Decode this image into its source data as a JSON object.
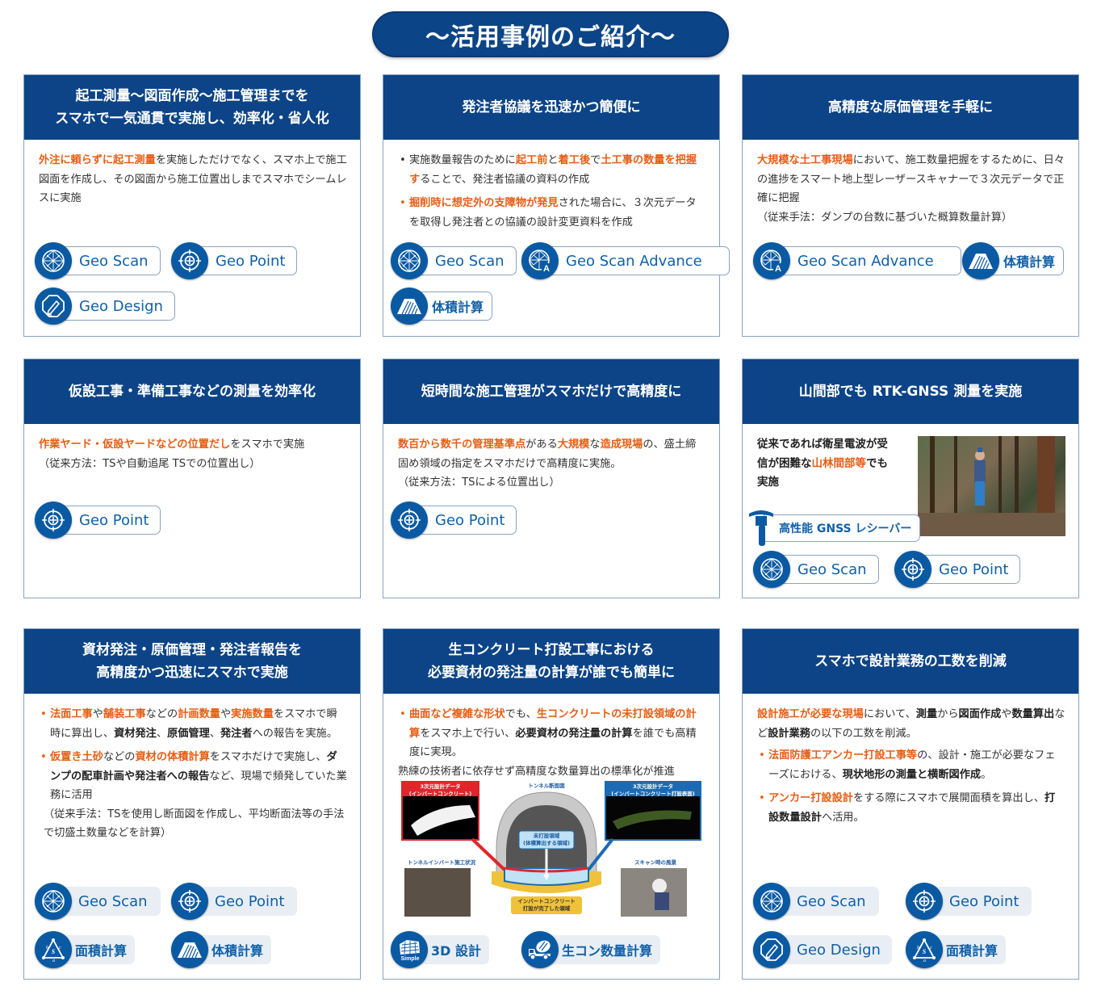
{
  "banner": {
    "title": "〜活用事例のご紹介〜"
  },
  "colors": {
    "navy": "#0c4487",
    "accent_orange": "#e85d13",
    "pill_blue": "#0a5aa3",
    "pill_text": "#1060a8"
  },
  "cards": [
    {
      "title_lines": [
        "起工測量〜図面作成〜施工管理までを",
        "スマホで一気通貫で実施し、効率化・省人化"
      ],
      "body": [
        {
          "t": "外注に頼らずに起工測量",
          "s": "hl"
        },
        {
          "t": "を実施しただけでなく、スマホ上で施工図面を作成し、その図面から施工位置出しまでスマホでシームレスに実施",
          "s": ""
        }
      ],
      "tools": [
        {
          "label": "Geo Scan",
          "icon": "geodesic-sphere-icon"
        },
        {
          "label": "Geo Point",
          "icon": "crosshair-target-icon"
        },
        {
          "label": "Geo Design",
          "icon": "pencil-octagon-icon"
        }
      ]
    },
    {
      "title_lines": [
        "発注者協議を迅速かつ簡便に"
      ],
      "bullets": [
        [
          {
            "t": "実施数量報告のために",
            "s": ""
          },
          {
            "t": "起工前",
            "s": "hl"
          },
          {
            "t": "と",
            "s": ""
          },
          {
            "t": "着工後",
            "s": "hl"
          },
          {
            "t": "で",
            "s": ""
          },
          {
            "t": "土工事の数量を把握す",
            "s": "hl"
          },
          {
            "t": "ることで、発注者協議の資料の作成",
            "s": ""
          }
        ],
        [
          {
            "t": "掘削時に想定外の支障物が発見",
            "s": "hl"
          },
          {
            "t": "された場合に、３次元データを取得し発注者との協議の設計変更資料を作成",
            "s": ""
          }
        ]
      ],
      "tools": [
        {
          "label": "Geo Scan",
          "icon": "geodesic-sphere-icon"
        },
        {
          "label": "Geo Scan Advance",
          "icon": "geodesic-sphere-a-icon"
        },
        {
          "label": "体積計算",
          "icon": "volume-mound-icon"
        }
      ]
    },
    {
      "title_lines": [
        "高精度な原価管理を手軽に"
      ],
      "body": [
        {
          "t": "大規模な土工事現場",
          "s": "hl"
        },
        {
          "t": "において、施工数量把握をするために、日々の進捗をスマート地上型レーザースキャナーで３次元データで正確に把握",
          "s": ""
        }
      ],
      "note": "（従来手法：ダンプの台数に基づいた概算数量計算）",
      "tools": [
        {
          "label": "Geo Scan Advance",
          "icon": "geodesic-sphere-a-icon"
        },
        {
          "label": "体積計算",
          "icon": "volume-mound-icon"
        }
      ]
    },
    {
      "title_lines": [
        "仮設工事・準備工事などの測量を効率化"
      ],
      "body": [
        {
          "t": "作業ヤード・仮設ヤードなどの位置だし",
          "s": "hl"
        },
        {
          "t": "をスマホで実施",
          "s": ""
        }
      ],
      "note": "（従来方法：TSや自動追尾 TSでの位置出し）",
      "tools": [
        {
          "label": "Geo Point",
          "icon": "crosshair-target-icon"
        }
      ]
    },
    {
      "title_lines": [
        "短時間な施工管理がスマホだけで高精度に"
      ],
      "body": [
        {
          "t": "数百から数千の管理基準点",
          "s": "hl"
        },
        {
          "t": "がある",
          "s": ""
        },
        {
          "t": "大規模",
          "s": "hl"
        },
        {
          "t": "な",
          "s": ""
        },
        {
          "t": "造成現場",
          "s": "hl"
        },
        {
          "t": "の、盛土締固め領域の指定をスマホだけで高精度に実施。",
          "s": ""
        }
      ],
      "note": "（従来方法：TSによる位置出し）",
      "tools": [
        {
          "label": "Geo Point",
          "icon": "crosshair-target-icon"
        }
      ]
    },
    {
      "title_lines": [
        "山間部でも RTK-GNSS 測量を実施"
      ],
      "body": [
        {
          "t": "従来であれば衛星電波が受信が困難な",
          "s": "bd"
        },
        {
          "t": "山林間部等",
          "s": "hl"
        },
        {
          "t": "でも実施",
          "s": "bd"
        }
      ],
      "receiver_label": "高性能 GNSS レシーバー",
      "photo_alt": "forest-survey-photo",
      "tools": [
        {
          "label": "Geo Scan",
          "icon": "geodesic-sphere-icon"
        },
        {
          "label": "Geo Point",
          "icon": "crosshair-target-icon"
        }
      ]
    },
    {
      "title_lines": [
        "資材発注・原価管理・発注者報告を",
        "高精度かつ迅速にスマホで実施"
      ],
      "bullets": [
        [
          {
            "t": "法面工事",
            "s": "hl"
          },
          {
            "t": "や",
            "s": ""
          },
          {
            "t": "舗装工事",
            "s": "hl"
          },
          {
            "t": "などの",
            "s": ""
          },
          {
            "t": "計画数量",
            "s": "hl"
          },
          {
            "t": "や",
            "s": ""
          },
          {
            "t": "実施数量",
            "s": "hl"
          },
          {
            "t": "をスマホで瞬時に算出し、",
            "s": ""
          },
          {
            "t": "資材発注",
            "s": "bd"
          },
          {
            "t": "、",
            "s": ""
          },
          {
            "t": "原価管理",
            "s": "bd"
          },
          {
            "t": "、",
            "s": ""
          },
          {
            "t": "発注者",
            "s": "bd"
          },
          {
            "t": "への報告を実施。",
            "s": ""
          }
        ],
        [
          {
            "t": "仮置き土砂",
            "s": "hl"
          },
          {
            "t": "などの",
            "s": ""
          },
          {
            "t": "資材の体積計算",
            "s": "hl"
          },
          {
            "t": "をスマホだけで実施し、",
            "s": ""
          },
          {
            "t": "ダンプの配車計画や発注者への報告",
            "s": "bd"
          },
          {
            "t": "など、現場で頻発していた業務に活用",
            "s": ""
          }
        ]
      ],
      "note": "（従来手法：TSを使用し断面図を作成し、平均断面法等の手法で切盛土数量などを計算）",
      "tools": [
        {
          "label": "Geo Scan",
          "icon": "geodesic-sphere-icon"
        },
        {
          "label": "Geo Point",
          "icon": "crosshair-target-icon"
        },
        {
          "label": "面積計算",
          "icon": "triangle-area-icon"
        },
        {
          "label": "体積計算",
          "icon": "volume-mound-icon"
        }
      ]
    },
    {
      "title_lines": [
        "生コンクリート打設工事における",
        "必要資材の発注量の計算が誰でも簡単に"
      ],
      "bullets": [
        [
          {
            "t": "曲面など複雑な形状",
            "s": "hl"
          },
          {
            "t": "でも、",
            "s": ""
          },
          {
            "t": "生コンクリートの未打設領域の計算",
            "s": "hl"
          },
          {
            "t": "をスマホ上で行い、",
            "s": ""
          },
          {
            "t": "必要資材の発注量の計算",
            "s": "bd"
          },
          {
            "t": "を誰でも高精度に実現。",
            "s": ""
          }
        ]
      ],
      "note": "熟練の技術者に依存せず高精度な数量算出の標準化が推進",
      "diagram": {
        "red_box_title": "3次元設計データ\n(インバートコンクリート)",
        "blue_box_title": "3次元設計データ\n(インバートコンクリート打設表面)",
        "center_title": "トンネル断面図",
        "inner_label": "未打設領域\n(体積算出する領域)",
        "bottom_label": "インバートコンクリート\n打設が完了した領域",
        "left_photo_label": "トンネルインバート施工状況",
        "right_photo_label": "スキャン時の風景"
      },
      "tools": [
        {
          "label": "3D 設計",
          "icon": "3d-simple-icon"
        },
        {
          "label": "生コン数量計算",
          "icon": "mixer-truck-icon"
        }
      ]
    },
    {
      "title_lines": [
        "スマホで設計業務の工数を削減"
      ],
      "body": [
        {
          "t": "設計施工が必要な現場",
          "s": "hl"
        },
        {
          "t": "において、",
          "s": ""
        },
        {
          "t": "測量",
          "s": "bd"
        },
        {
          "t": "から",
          "s": ""
        },
        {
          "t": "図面作成",
          "s": "bd"
        },
        {
          "t": "や",
          "s": ""
        },
        {
          "t": "数量算出",
          "s": "bd"
        },
        {
          "t": "など",
          "s": ""
        },
        {
          "t": "設計業務",
          "s": "bd"
        },
        {
          "t": "の以下の工数を削減。",
          "s": ""
        }
      ],
      "bullets": [
        [
          {
            "t": "法面防護工アンカー打設工事等",
            "s": "hl"
          },
          {
            "t": "の、設計・施工が必要なフェーズにおける、",
            "s": ""
          },
          {
            "t": "現状地形の測量と横断図作成",
            "s": "bd"
          },
          {
            "t": "。",
            "s": ""
          }
        ],
        [
          {
            "t": "アンカー打設設計",
            "s": "hl"
          },
          {
            "t": "をする際にスマホで展開面積を算出し、",
            "s": ""
          },
          {
            "t": "打設数量設計",
            "s": "bd"
          },
          {
            "t": "へ活用。",
            "s": ""
          }
        ]
      ],
      "tools": [
        {
          "label": "Geo Scan",
          "icon": "geodesic-sphere-icon"
        },
        {
          "label": "Geo Point",
          "icon": "crosshair-target-icon"
        },
        {
          "label": "Geo Design",
          "icon": "pencil-octagon-icon"
        },
        {
          "label": "面積計算",
          "icon": "triangle-area-icon"
        }
      ]
    }
  ]
}
